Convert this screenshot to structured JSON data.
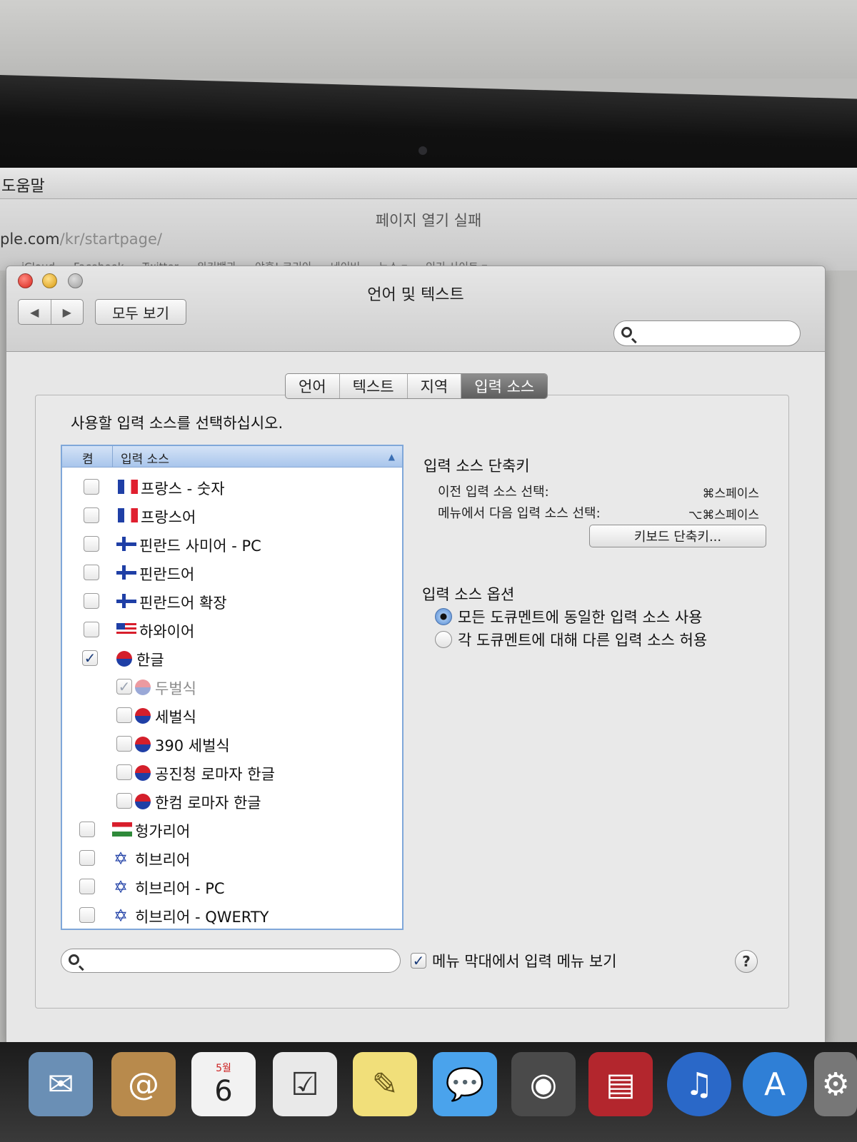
{
  "menubar": {
    "help": "도움말"
  },
  "browser": {
    "title": "페이지 열기 실패",
    "url_host": "ple.com",
    "url_path": "/kr/startpage/",
    "bookmarks": [
      "iCloud",
      "Facebook",
      "Twitter",
      "위키백과",
      "야후! 코리아",
      "네이버",
      "뉴스 ▾",
      "인기 사이트 ▾"
    ]
  },
  "window": {
    "title": "언어 및 텍스트",
    "show_all": "모두 보기",
    "tabs": [
      {
        "label": "언어"
      },
      {
        "label": "텍스트"
      },
      {
        "label": "지역"
      },
      {
        "label": "입력 소스"
      }
    ],
    "instruction": "사용할 입력 소스를 선택하십시오."
  },
  "list": {
    "header_on": "켬",
    "header_source": "입력 소스",
    "rows": [
      {
        "label": "프랑스 - 숫자"
      },
      {
        "label": "프랑스어"
      },
      {
        "label": "핀란드 사미어 - PC"
      },
      {
        "label": "핀란드어"
      },
      {
        "label": "핀란드어 확장"
      },
      {
        "label": "하와이어"
      },
      {
        "label": "한글",
        "checked": true
      },
      {
        "label": "두벌식",
        "checked": true
      },
      {
        "label": "세벌식"
      },
      {
        "label": "390 세벌식"
      },
      {
        "label": "공진청 로마자 한글"
      },
      {
        "label": "한컴 로마자 한글"
      },
      {
        "label": "헝가리어"
      },
      {
        "label": "히브리어"
      },
      {
        "label": "히브리어 - PC"
      },
      {
        "label": "히브리어 - QWERTY"
      }
    ]
  },
  "shortcuts": {
    "title": "입력 소스 단축키",
    "prev_label": "이전 입력 소스 선택:",
    "prev_key": "⌘스페이스",
    "next_label": "메뉴에서 다음 입력 소스 선택:",
    "next_key": "⌥⌘스페이스",
    "kbd_button": "키보드 단축키..."
  },
  "options": {
    "title": "입력 소스 옵션",
    "same_for_all": "모든 도큐멘트에 동일한 입력 소스 사용",
    "per_document": "각 도큐멘트에 대해 다른 입력 소스 허용",
    "selected": "same_for_all"
  },
  "bottom": {
    "menu_check_label": "메뉴 막대에서 입력 메뉴 보기",
    "menu_check_checked": true,
    "help": "?"
  },
  "dock": {
    "calendar_month": "5월",
    "calendar_day": "6"
  },
  "colors": {
    "accent": "#4f86d1",
    "list_border": "#7fa7d9"
  }
}
